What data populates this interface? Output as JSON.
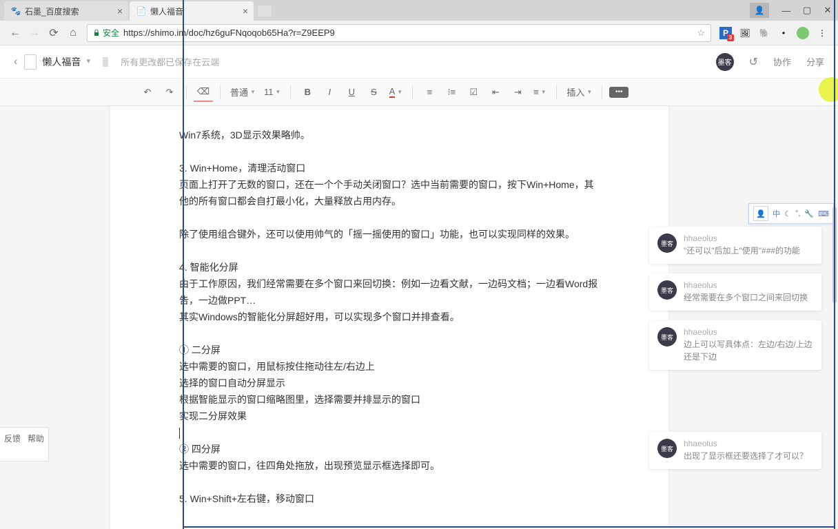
{
  "browser": {
    "tab1": "石墨_百度搜索",
    "tab2": "懒人福音",
    "secure_label": "安全",
    "url": "https://shimo.im/doc/hz6guFNqoqob65Ha?r=Z9EEP9",
    "ext_badge": "3"
  },
  "header": {
    "doc_title": "懒人福音",
    "save_status": "所有更改都已保存在云端",
    "collab": "协作",
    "share": "分享",
    "avatar_text": "墨客"
  },
  "toolbar": {
    "style": "普通",
    "fontsize": "11",
    "bold": "B",
    "italic": "I",
    "underline": "U",
    "strike": "S",
    "color": "A",
    "insert": "插入"
  },
  "content": {
    "l1": "Win7系统，3D显示效果略帅。",
    "l2": "3.  Win+Home，清理活动窗口",
    "l3": "页面上打开了无数的窗口，还在一个个手动关闭窗口？选中当前需要的窗口，按下Win+Home，其他的所有窗口都会自打最小化，大量释放占用内存。",
    "l4": "除了使用组合键外，还可以使用帅气的「摇一摇使用的窗口」功能，也可以实现同样的效果。",
    "l5": "4.  智能化分屏",
    "l6": "由于工作原因，我们经常需要在多个窗口来回切换：例如一边看文献，一边码文档；一边看Word报告，一边做PPT…",
    "l7": "其实Windows的智能化分屏超好用，可以实现多个窗口并排查看。",
    "l8": "① 二分屏",
    "l9": "选中需要的窗口，用鼠标按住拖动往左/右边上",
    "l10": "选择的窗口自动分屏显示",
    "l11": "根据智能显示的窗口缩略图里，选择需要并排显示的窗口",
    "l12": "实现二分屏效果",
    "l13": "② 四分屏",
    "l14": "选中需要的窗口，往四角处拖放，出现预览显示框选择即可。",
    "l15": "5.  Win+Shift+左右键，移动窗口"
  },
  "comments": {
    "user": "hhaeolus",
    "c1": "\"还可以\"后加上\"使用\"###的功能",
    "c2": "经常需要在多个窗口之间来回切换",
    "c3": "边上可以写具体点：左边/右边/上边还是下边",
    "c4": "出现了显示框还要选择了才可以？"
  },
  "collab": {
    "ime": "中"
  },
  "feedback": {
    "t1": "反馈",
    "t2": "帮助"
  }
}
